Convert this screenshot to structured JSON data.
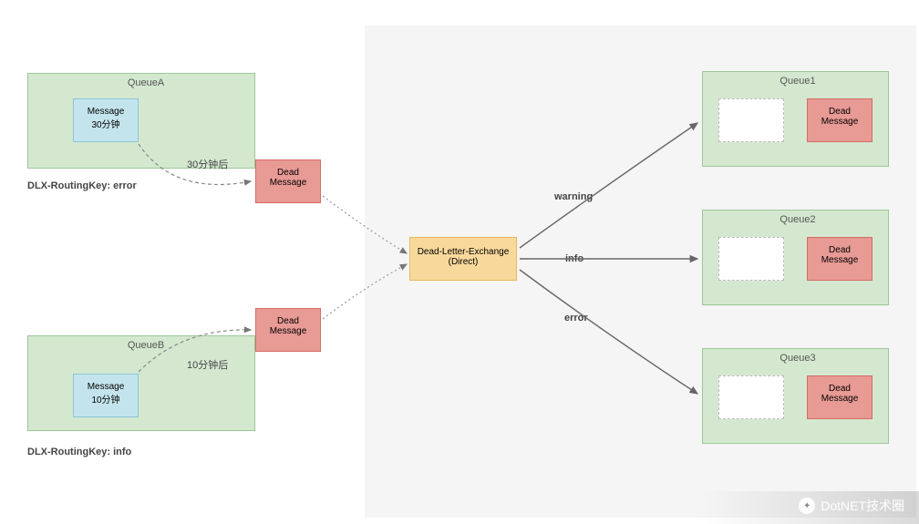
{
  "queueA": {
    "title": "QueueA",
    "msg_line1": "Message",
    "msg_line2": "30分钟",
    "dead_line1": "Dead",
    "dead_line2": "Message",
    "after": "30分钟后",
    "routing": "DLX-RoutingKey: error"
  },
  "queueB": {
    "title": "QueueB",
    "msg_line1": "Message",
    "msg_line2": "10分钟",
    "dead_line1": "Dead",
    "dead_line2": "Message",
    "after": "10分钟后",
    "routing": "DLX-RoutingKey: info"
  },
  "exchange": {
    "line1": "Dead-Letter-Exchange",
    "line2": "(Direct)"
  },
  "routes": {
    "r1": "warning",
    "r2": "info",
    "r3": "error"
  },
  "queue1": {
    "title": "Queue1",
    "dead_line1": "Dead",
    "dead_line2": "Message"
  },
  "queue2": {
    "title": "Queue2",
    "dead_line1": "Dead",
    "dead_line2": "Message"
  },
  "queue3": {
    "title": "Queue3",
    "dead_line1": "Dead",
    "dead_line2": "Message"
  },
  "watermark": "DotNET技术圈",
  "colors": {
    "green": "#d4e8d0",
    "blue": "#c4e4ed",
    "red": "#e89a95",
    "orange": "#f9d99b",
    "gray": "#f5f5f5"
  }
}
